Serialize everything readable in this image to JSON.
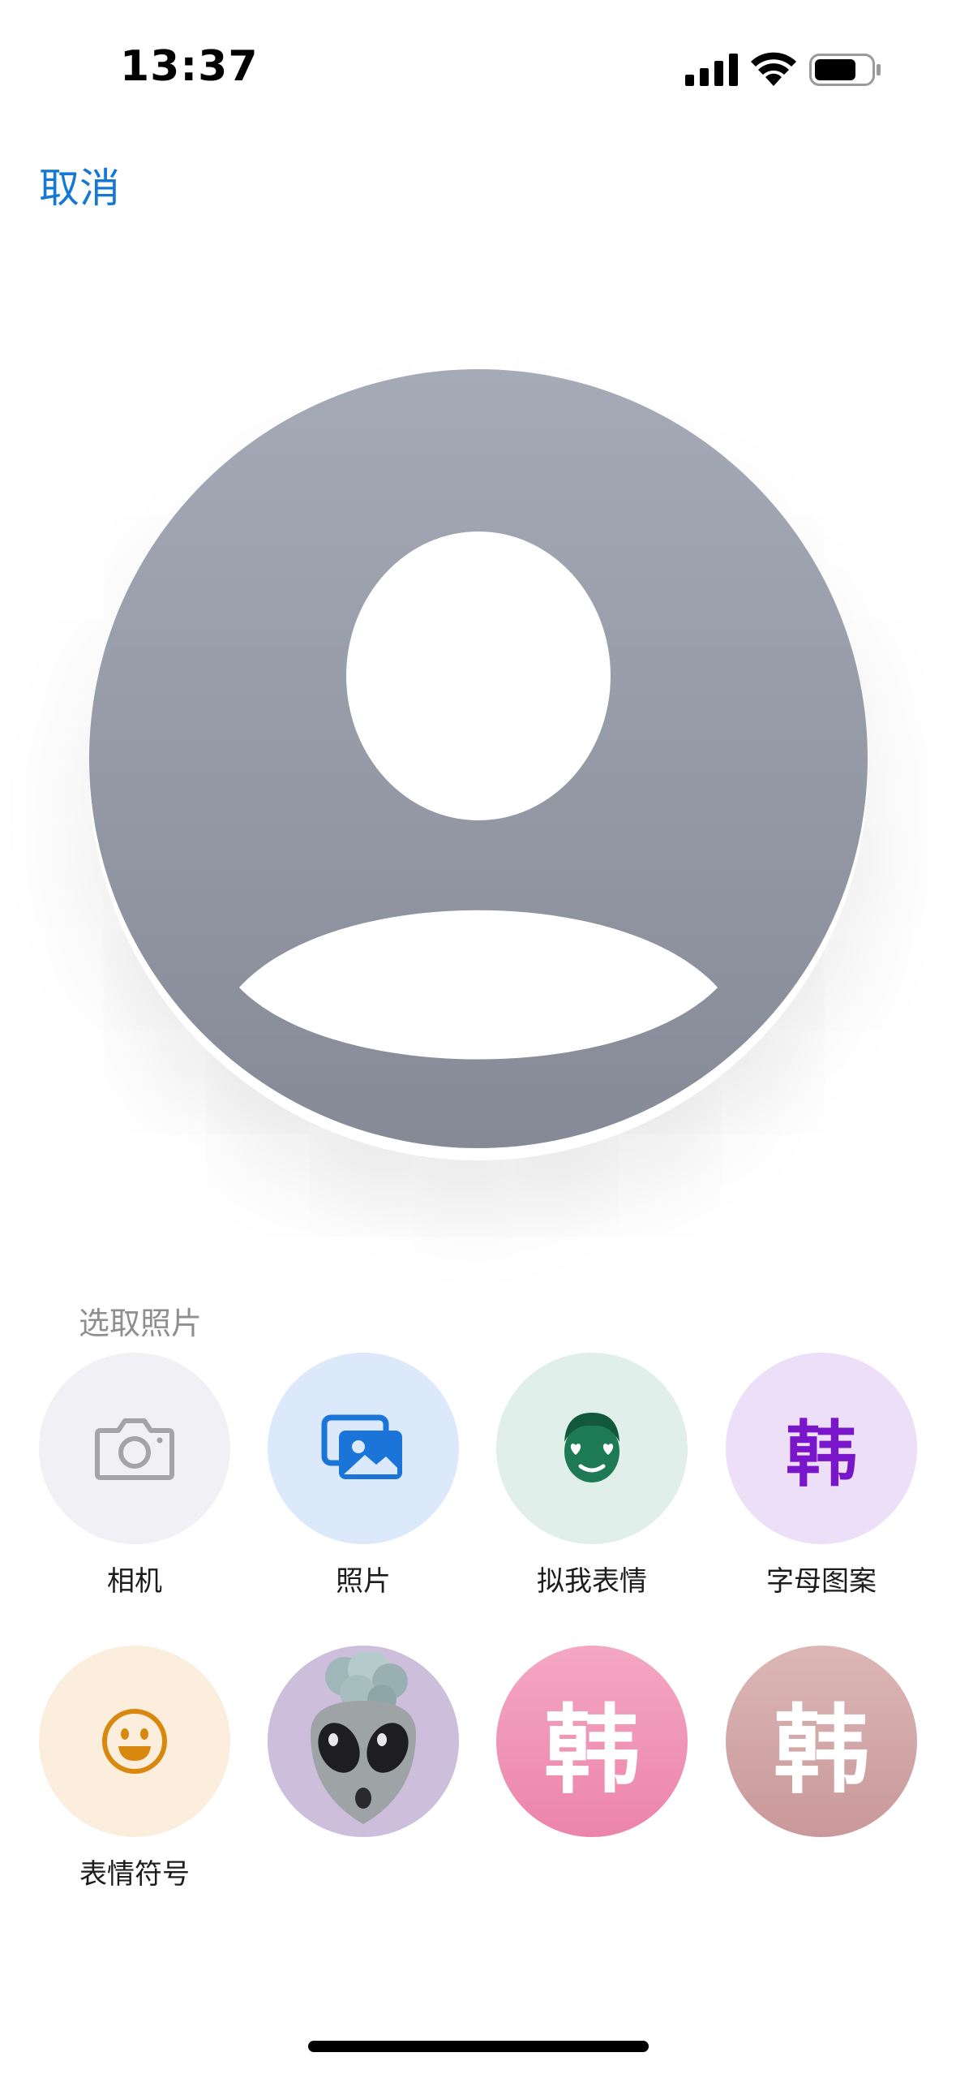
{
  "status_bar": {
    "time": "13:37"
  },
  "nav": {
    "cancel_label": "取消"
  },
  "picker": {
    "section_title": "选取照片",
    "options": [
      {
        "label": "相机",
        "icon": "camera-icon",
        "bg": "#f0f0f5"
      },
      {
        "label": "照片",
        "icon": "photos-icon",
        "bg": "#dbe9fb"
      },
      {
        "label": "拟我表情",
        "icon": "memoji-icon",
        "bg": "#e0efe9"
      },
      {
        "label": "字母图案",
        "icon": "monogram-icon",
        "glyph": "韩",
        "bg": "#eedff8"
      },
      {
        "label": "表情符号",
        "icon": "smiley-icon",
        "bg": "#fbeedc"
      },
      {
        "label": "",
        "icon": "alien-memoji-icon",
        "bg": "#cdbfdc"
      },
      {
        "label": "",
        "icon": "monogram-pink-icon",
        "glyph": "韩",
        "bg": "#ee8fb0"
      },
      {
        "label": "",
        "icon": "monogram-rose-icon",
        "glyph": "韩",
        "bg": "#cfa3a1"
      }
    ]
  },
  "colors": {
    "accent": "#1478d4",
    "avatar_top": "#a3a8b5",
    "avatar_bottom": "#868b97"
  }
}
